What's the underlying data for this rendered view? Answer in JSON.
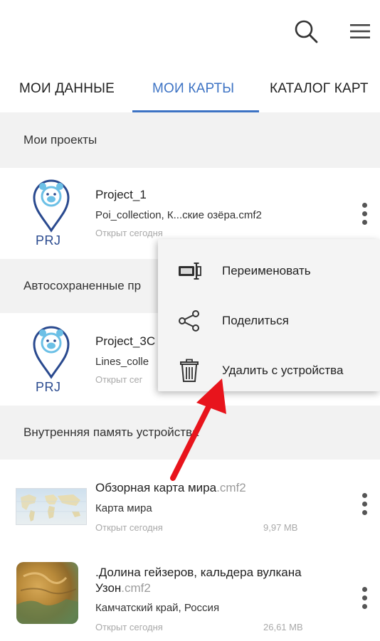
{
  "header": {
    "search_icon": "search-icon",
    "menu_icon": "hamburger-menu-icon"
  },
  "tabs": [
    {
      "label": "МОИ ДАННЫЕ",
      "active": false
    },
    {
      "label": "МОИ КАРТЫ",
      "active": true
    },
    {
      "label": "КАТАЛОГ КАРТ",
      "active": false
    }
  ],
  "accent_color": "#3d73c4",
  "sections": {
    "projects": "Мои проекты",
    "autosaved": "Автосохраненные пр",
    "internal": "Внутренняя память устройства"
  },
  "items": [
    {
      "thumb_label": "PRJ",
      "title": "Project_1",
      "subtitle": "Poi_collection, К...ские озёра.cmf2",
      "meta": "Открыт сегодня"
    },
    {
      "thumb_label": "PRJ",
      "title": "Project_3C",
      "subtitle": "Lines_colle",
      "meta": "Открыт сег"
    },
    {
      "title": "Обзорная карта мира",
      "ext": ".cmf2",
      "subtitle": "Карта мира",
      "meta": "Открыт сегодня",
      "size": "9,97 MB"
    },
    {
      "title": ".Долина гейзеров, кальдера вулкана Узон",
      "ext": ".cmf2",
      "subtitle": "Камчатский край, Россия",
      "meta": "Открыт сегодня",
      "size": "26,61 MB"
    }
  ],
  "context_menu": [
    {
      "label": "Переименовать",
      "icon": "rename-icon"
    },
    {
      "label": "Поделиться",
      "icon": "share-icon"
    },
    {
      "label": "Удалить с устройства",
      "icon": "trash-icon"
    }
  ],
  "annotation": {
    "arrow_color": "#e8141c"
  }
}
